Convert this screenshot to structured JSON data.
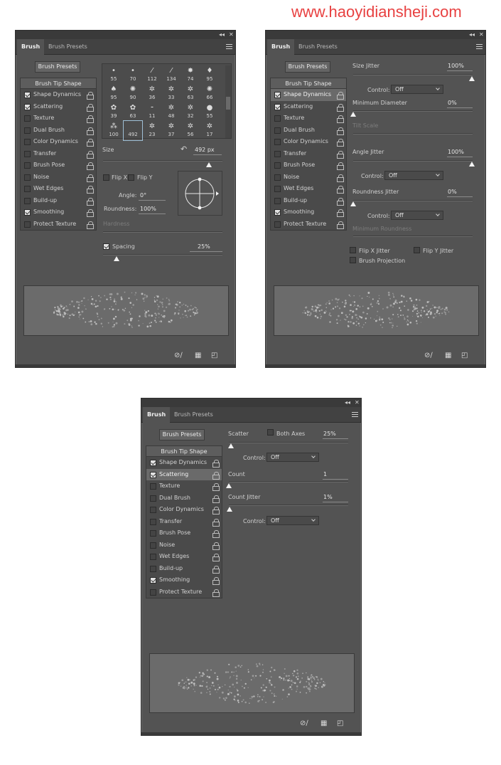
{
  "watermark": "www.haoyidiansheji.com",
  "tabs": {
    "brush": "Brush",
    "presets": "Brush Presets"
  },
  "brush_presets_button": "Brush Presets",
  "settings_list": [
    {
      "label": "Brush Tip Shape",
      "checkbox": false
    },
    {
      "label": "Shape Dynamics",
      "checkbox": true,
      "checked": true
    },
    {
      "label": "Scattering",
      "checkbox": true,
      "checked": true
    },
    {
      "label": "Texture",
      "checkbox": true,
      "checked": false
    },
    {
      "label": "Dual Brush",
      "checkbox": true,
      "checked": false
    },
    {
      "label": "Color Dynamics",
      "checkbox": true,
      "checked": false
    },
    {
      "label": "Transfer",
      "checkbox": true,
      "checked": false
    },
    {
      "label": "Brush Pose",
      "checkbox": true,
      "checked": false
    },
    {
      "label": "Noise",
      "checkbox": true,
      "checked": false
    },
    {
      "label": "Wet Edges",
      "checkbox": true,
      "checked": false
    },
    {
      "label": "Build-up",
      "checkbox": true,
      "checked": false
    },
    {
      "label": "Smoothing",
      "checkbox": true,
      "checked": true
    },
    {
      "label": "Protect Texture",
      "checkbox": true,
      "checked": false
    }
  ],
  "panel1": {
    "tips": [
      "55",
      "70",
      "112",
      "134",
      "74",
      "95",
      "95",
      "90",
      "36",
      "33",
      "63",
      "66",
      "39",
      "63",
      "11",
      "48",
      "32",
      "55",
      "100",
      "492",
      "23",
      "37",
      "56",
      "17"
    ],
    "size_label": "Size",
    "size_value": "492 px",
    "flip_x": "Flip X",
    "flip_y": "Flip Y",
    "angle_label": "Angle:",
    "angle_value": "0°",
    "roundness_label": "Roundness:",
    "roundness_value": "100%",
    "hardness_label": "Hardness",
    "spacing_label": "Spacing",
    "spacing_value": "25%",
    "size_level": 0.83,
    "spacing_level": 0.09
  },
  "panel2": {
    "size_jitter_label": "Size Jitter",
    "size_jitter_value": "100%",
    "control_label": "Control:",
    "control_value": "Off",
    "min_diameter_label": "Minimum Diameter",
    "min_diameter_value": "0%",
    "tilt_scale_label": "Tilt Scale",
    "angle_jitter_label": "Angle Jitter",
    "angle_jitter_value": "100%",
    "roundness_jitter_label": "Roundness Jitter",
    "roundness_jitter_value": "0%",
    "min_roundness_label": "Minimum Roundness",
    "flip_x_jitter": "Flip X Jitter",
    "flip_y_jitter": "Flip Y Jitter",
    "brush_projection": "Brush Projection"
  },
  "panel3": {
    "scatter_label": "Scatter",
    "both_axes_label": "Both Axes",
    "scatter_value": "25%",
    "control_label": "Control:",
    "control_value": "Off",
    "count_label": "Count",
    "count_value": "1",
    "count_jitter_label": "Count Jitter",
    "count_jitter_value": "1%"
  }
}
